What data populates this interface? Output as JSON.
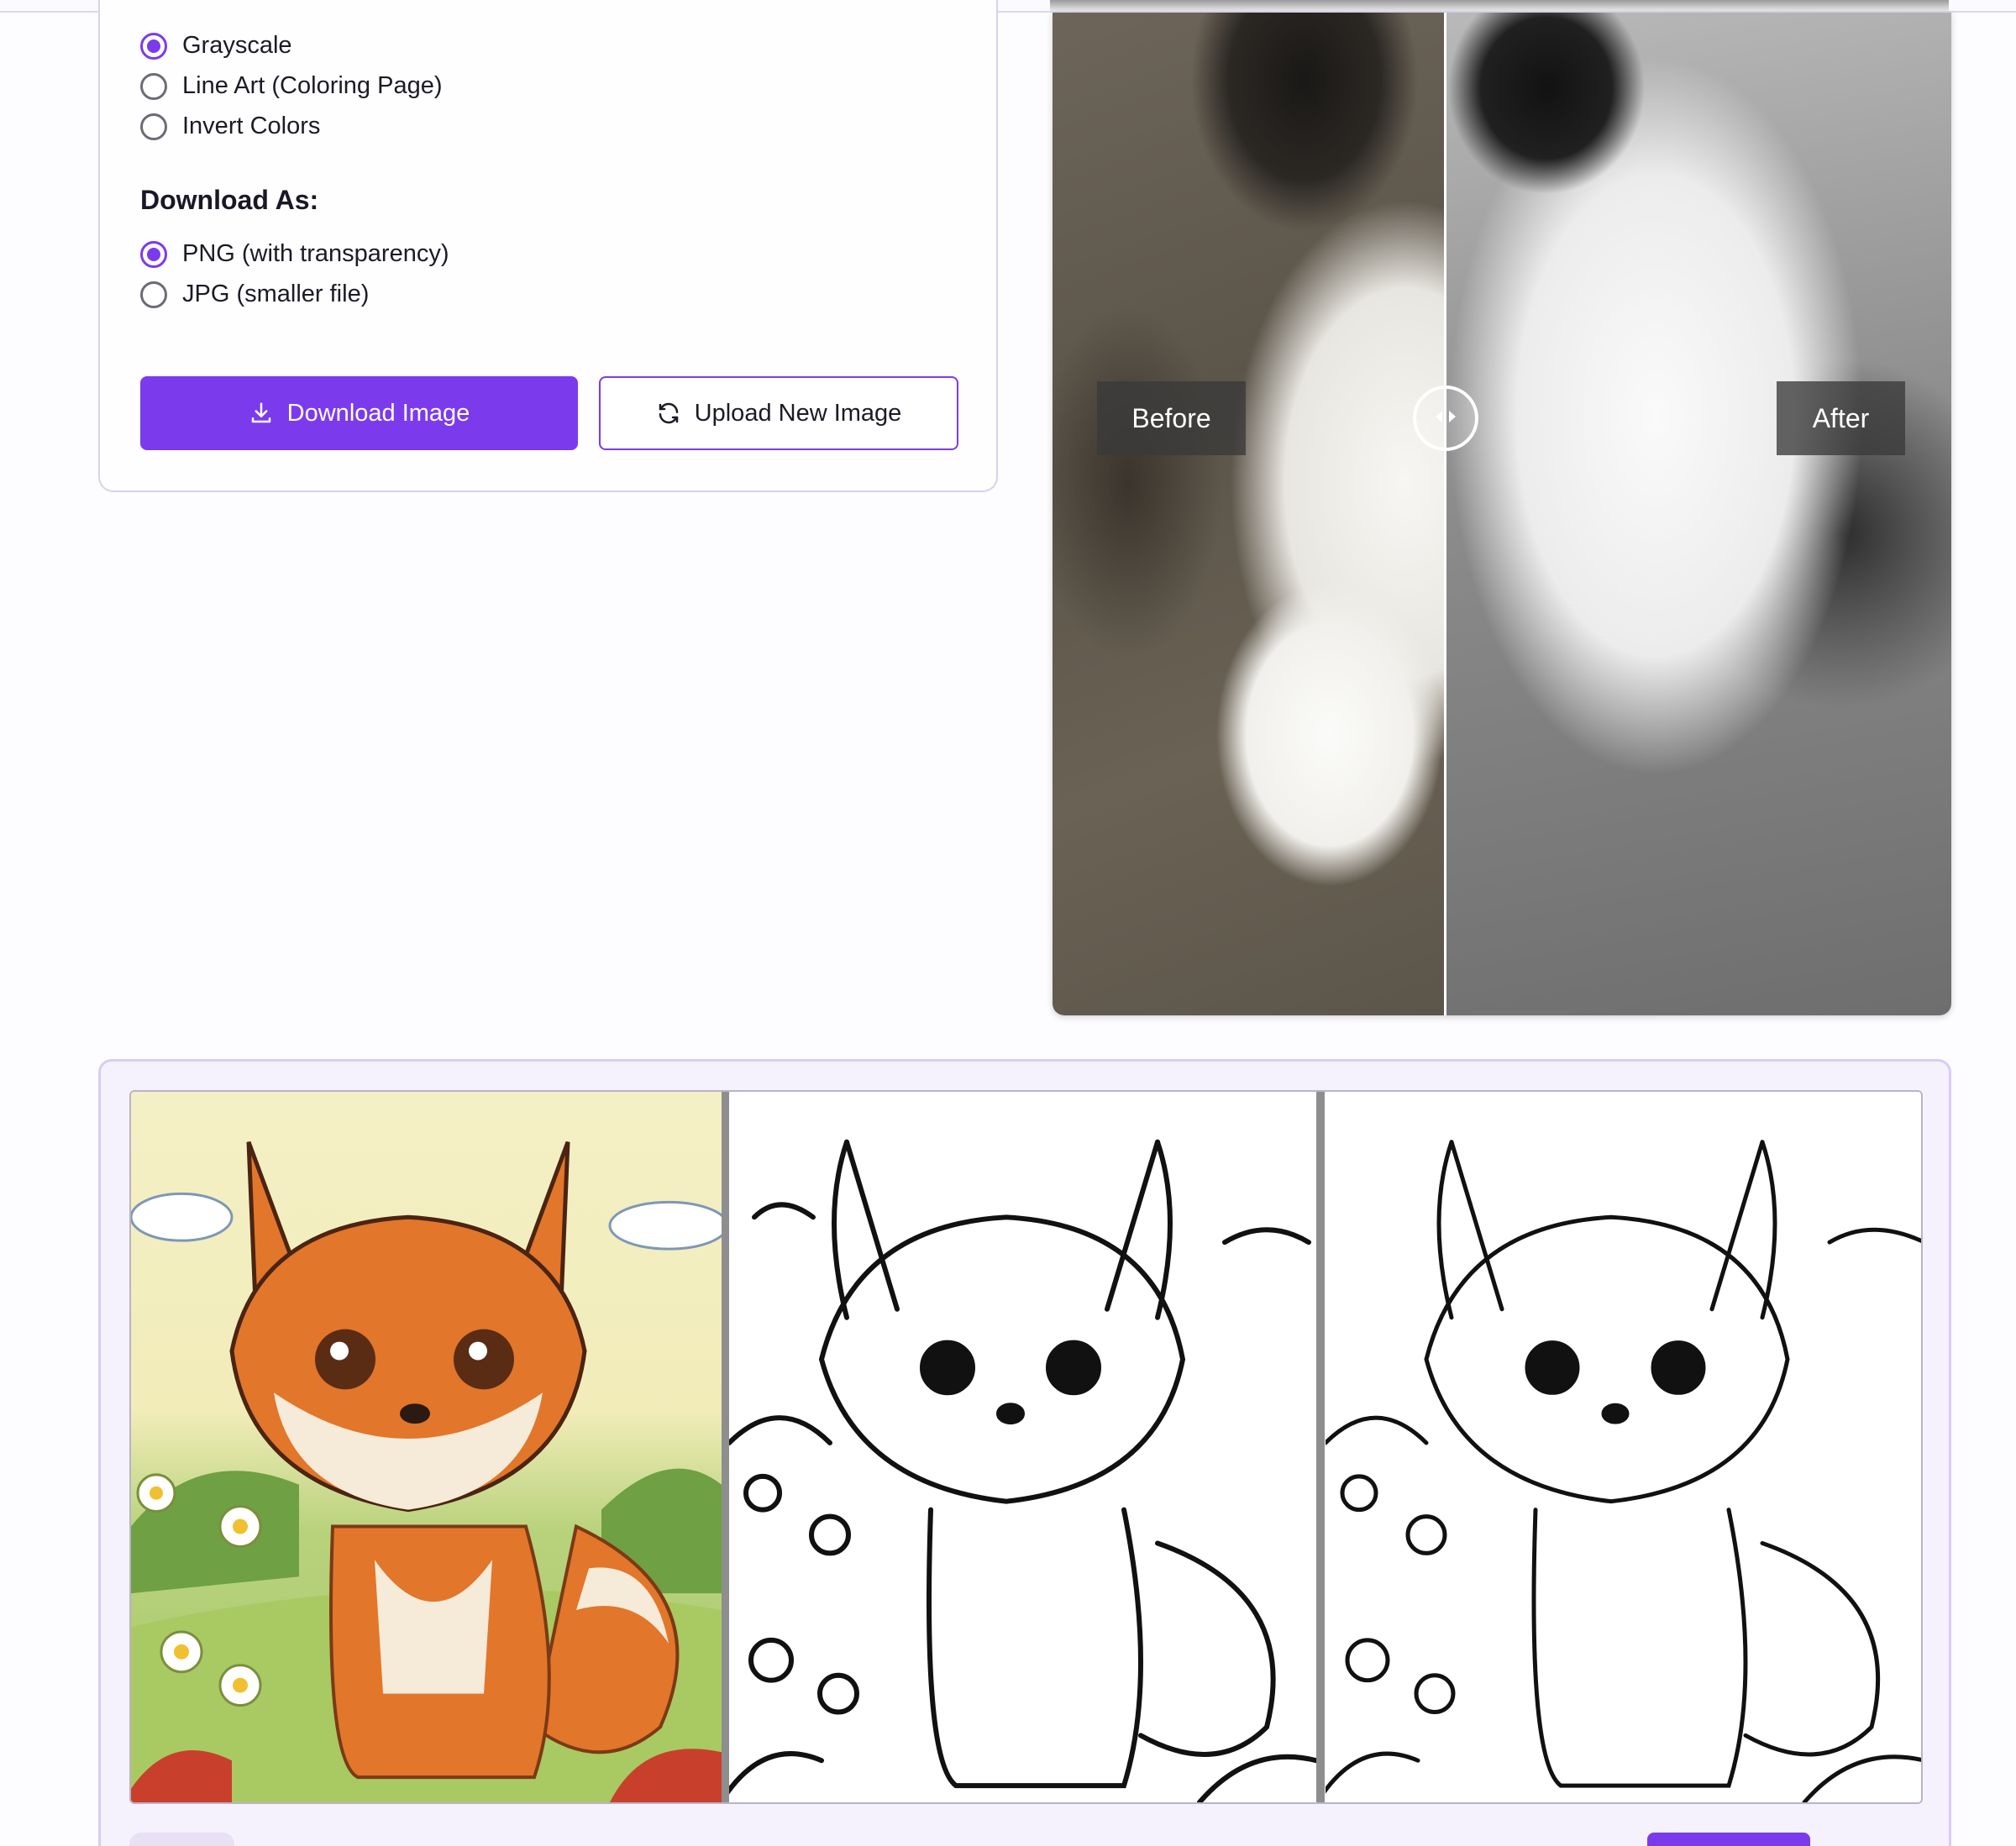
{
  "options": {
    "style_choices": [
      {
        "label": "Grayscale",
        "checked": true
      },
      {
        "label": "Line Art (Coloring Page)",
        "checked": false
      },
      {
        "label": "Invert Colors",
        "checked": false
      }
    ],
    "download_heading": "Download As:",
    "format_choices": [
      {
        "label": "PNG (with transparency)",
        "checked": true
      },
      {
        "label": "JPG (smaller file)",
        "checked": false
      }
    ],
    "download_button": "Download Image",
    "upload_button": "Upload New Image"
  },
  "compare": {
    "before_label": "Before",
    "after_label": "After",
    "slider_position": 0.44
  },
  "gallery": {
    "tiles": [
      "color-fox-illustration",
      "line-art-fox-1",
      "line-art-fox-2"
    ],
    "footer_text": "",
    "footer_button": ""
  },
  "colors": {
    "accent": "#7c3aed",
    "card_border": "#d9d2ea",
    "gallery_bg": "#f6f2fd"
  },
  "icons": [
    "download-icon",
    "refresh-icon",
    "chevron-left-right-icon"
  ]
}
